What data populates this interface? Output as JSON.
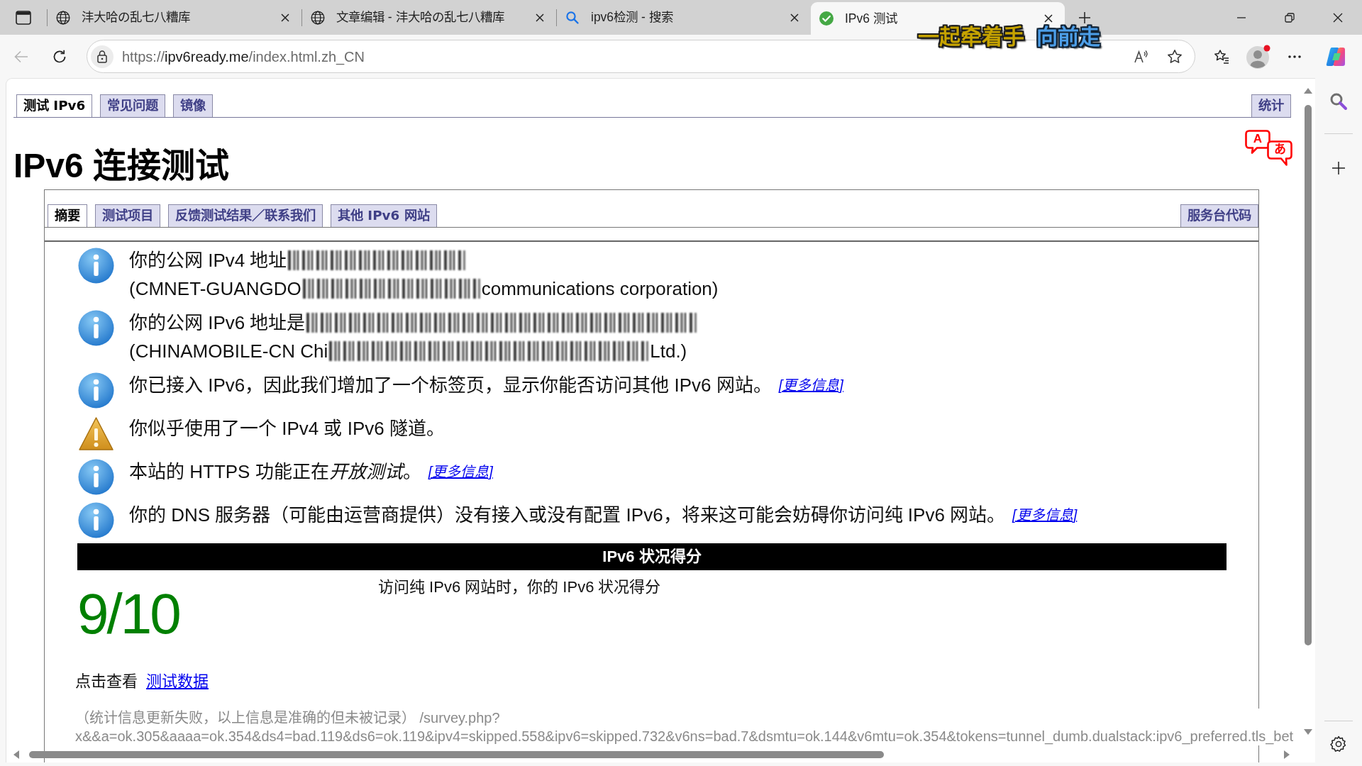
{
  "browser": {
    "tabs": [
      {
        "kind": "globe",
        "title": "沣大哈の乱七八糟库",
        "selected": false
      },
      {
        "kind": "globe",
        "title": "文章编辑 - 沣大哈の乱七八糟库",
        "selected": false
      },
      {
        "kind": "search",
        "title": "ipv6检测 - 搜索",
        "selected": false
      },
      {
        "kind": "check",
        "title": "IPv6 测试",
        "selected": true
      }
    ],
    "back_button": {
      "disabled": true
    },
    "address_bar": {
      "scheme": "https://",
      "host": "ipv6ready.me",
      "path": "/index.html.zh_CN"
    },
    "lyrics": {
      "sung": "一起牵着手",
      "upcoming": "向前走"
    }
  },
  "page": {
    "nav_tabs": [
      {
        "label": "测试 IPv6",
        "selected": true
      },
      {
        "label": "常见问题",
        "selected": false
      },
      {
        "label": "镜像",
        "selected": false
      }
    ],
    "nav_right_tab": {
      "label": "统计",
      "selected": false
    },
    "language_switch": [
      "A",
      "あ"
    ],
    "title": "IPv6 连接测试",
    "sub_tabs": [
      {
        "label": "摘要",
        "selected": true
      },
      {
        "label": "测试项目",
        "selected": false
      },
      {
        "label": "反馈测试结果／联系我们",
        "selected": false
      },
      {
        "label": "其他 IPv6 网站",
        "selected": false
      }
    ],
    "sub_right_tab": {
      "label": "服务台代码",
      "selected": false
    },
    "messages": [
      {
        "kind": "info",
        "lines": [
          [
            {
              "kind": "text",
              "text": "你的公网 IPv4 地址"
            },
            {
              "kind": "blur_short"
            }
          ],
          [
            {
              "kind": "text",
              "text": "(CMNET-GUANGDO"
            },
            {
              "kind": "blur_short"
            },
            {
              "kind": "text",
              "text": "communications corporation)"
            }
          ]
        ]
      },
      {
        "kind": "info",
        "lines": [
          [
            {
              "kind": "text",
              "text": "你的公网 IPv6 地址是"
            },
            {
              "kind": "blur_long"
            }
          ],
          [
            {
              "kind": "text",
              "text": "(CHINAMOBILE-CN Chi"
            },
            {
              "kind": "blur_medium"
            },
            {
              "kind": "text",
              "text": "Ltd.)"
            }
          ]
        ]
      },
      {
        "kind": "info",
        "lines": [
          [
            {
              "kind": "text",
              "text": "你已接入 IPv6，因此我们增加了一个标签页，显示你能否访问其他 IPv6 网站。"
            }
          ]
        ],
        "link": "[更多信息]"
      },
      {
        "kind": "warning",
        "lines": [
          [
            {
              "kind": "text",
              "text": "你似乎使用了一个 IPv4 或 IPv6 隧道。"
            }
          ]
        ]
      },
      {
        "kind": "info",
        "lines": [
          [
            {
              "kind": "styled_text",
              "parts": [
                {
                  "text": "本站的 HTTPS 功能正在",
                  "italic": false
                },
                {
                  "text": "开放测试",
                  "italic": true
                },
                {
                  "text": "。",
                  "italic": false
                }
              ]
            }
          ]
        ],
        "link": "[更多信息]"
      },
      {
        "kind": "info",
        "lines": [
          [
            {
              "kind": "text",
              "text": "你的 DNS 服务器（可能由运营商提供）没有接入或没有配置 IPv6，将来这可能会妨碍你访问纯 IPv6 网站。"
            }
          ]
        ],
        "link": "[更多信息]"
      }
    ],
    "score": {
      "heading": "IPv6 状况得分",
      "value": "9/10",
      "caption": "访问纯 IPv6 网站时，你的 IPv6 状况得分"
    },
    "test_data": {
      "prefix": "点击查看",
      "link": "测试数据"
    },
    "stats_note": {
      "lines": [
        "（统计信息更新失败，以上信息是准确的但未被记录） /survey.php?",
        "x&&a=ok.305&aaaa=ok.354&ds4=bad.119&ds6=ok.119&ipv4=skipped.558&ipv6=skipped.732&v6ns=bad.7&dsmtu=ok.144&v6mtu=ok.354&tokens=tunnel_dumb.dualstack:ipv6_preferred.tls_bet"
      ]
    }
  }
}
